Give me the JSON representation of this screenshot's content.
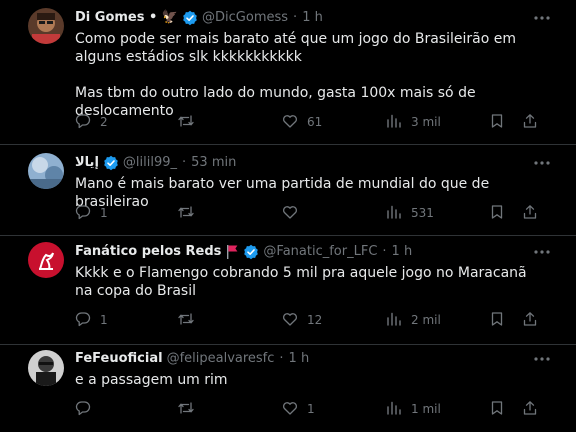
{
  "tweets": [
    {
      "name": "Di Gomes • 🦅",
      "handle": "@DicGomess",
      "dot": "·",
      "time": "1 h",
      "text": "Como pode ser mais barato até que um jogo do Brasileirão em alguns estádios slk kkkkkkkkkkk\n\nMas tbm do outro lado do mundo, gasta 100x mais só de deslocamento",
      "replies": "2",
      "reposts": "",
      "likes": "61",
      "views": "3 mil"
    },
    {
      "name": "إيالا",
      "handle": "@lilil99_",
      "dot": "·",
      "time": "53 min",
      "text": "Mano é mais barato ver uma partida de mundial do que de brasileirao",
      "replies": "1",
      "reposts": "",
      "likes": "",
      "views": "531"
    },
    {
      "name": "Fanático pelos Reds",
      "flag": "🚩",
      "handle": "@Fanatic_for_LFC",
      "dot": "·",
      "time": "1 h",
      "text": "Kkkk e o Flamengo cobrando 5 mil pra aquele jogo no Maracanã na copa do Brasil",
      "replies": "1",
      "reposts": "",
      "likes": "12",
      "views": "2 mil"
    },
    {
      "name": "FeFeuoficial",
      "handle": "@felipealvaresfc",
      "dot": "·",
      "time": "1 h",
      "text": "e a passagem um rim",
      "replies": "",
      "reposts": "",
      "likes": "1",
      "views": "1 mil"
    }
  ],
  "icons": {
    "verified": "verified-badge-icon",
    "more": "more-icon",
    "reply": "reply-icon",
    "repost": "repost-icon",
    "like": "like-icon",
    "views": "views-icon",
    "bookmark": "bookmark-icon",
    "share": "share-icon"
  },
  "colors": {
    "background": "#000000",
    "text": "#e7e9ea",
    "secondary": "#71767b",
    "verified": "#1d9bf0",
    "divider": "#2f3336"
  }
}
